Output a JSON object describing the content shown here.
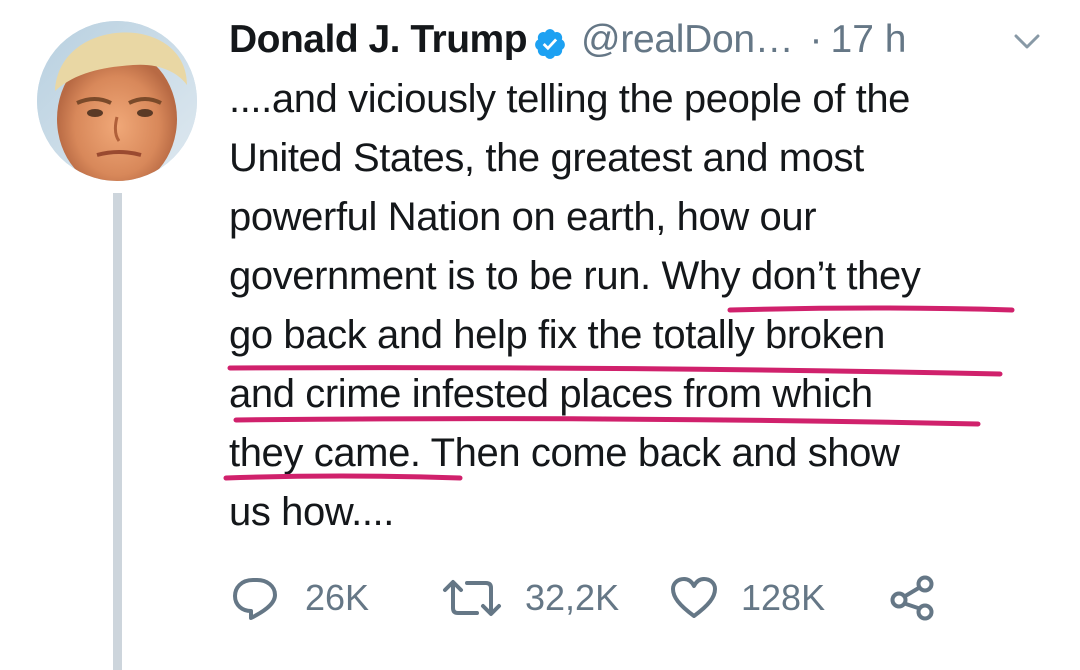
{
  "tweet": {
    "author_name": "Donald J. Trump",
    "handle": "@realDon…",
    "separator": "·",
    "time": "17 h",
    "lines": [
      "....and viciously telling the people of the",
      "United States, the greatest and most",
      "powerful Nation on earth, how our",
      "government is to be run. Why don’t they",
      "go back and help fix the totally broken",
      "and crime infested places from which",
      "they came. Then come back and show",
      "us how...."
    ]
  },
  "actions": {
    "replies": "26K",
    "retweets": "32,2K",
    "likes": "128K"
  },
  "colors": {
    "text": "#14171a",
    "secondary": "#657786",
    "verified": "#1da1f2",
    "underline": "#d0216c",
    "thread_line": "#cdd5dc"
  },
  "icons": [
    "verified-badge-icon",
    "chevron-down-icon",
    "reply-icon",
    "retweet-icon",
    "like-icon",
    "share-icon"
  ]
}
